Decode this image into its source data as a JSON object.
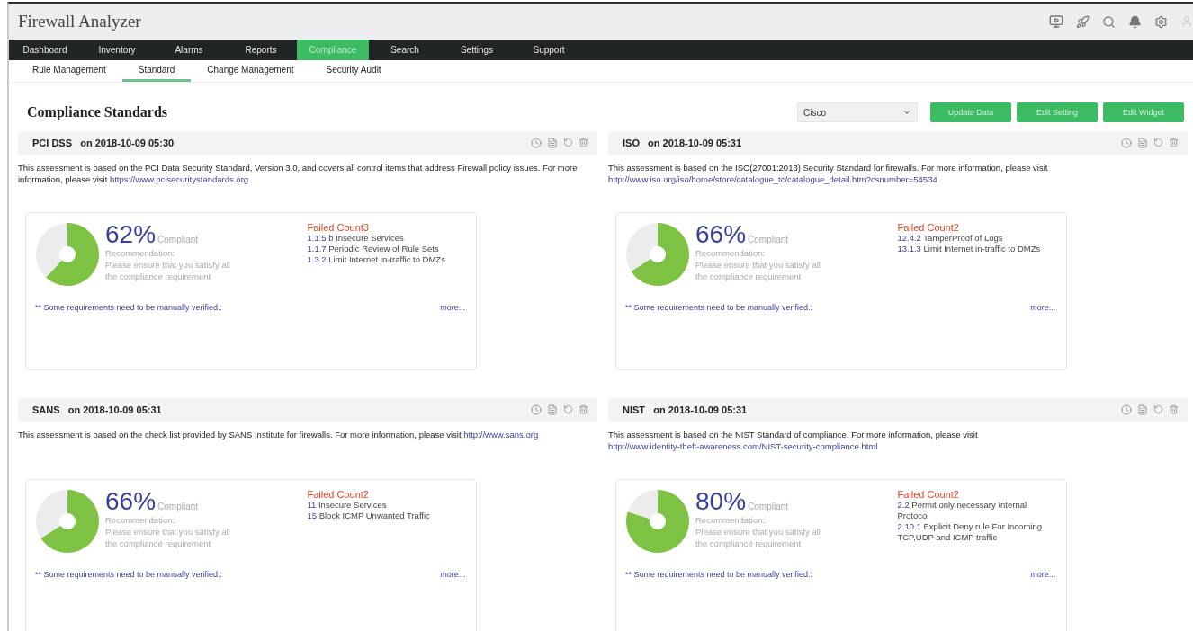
{
  "app_title": "Firewall Analyzer",
  "nav": [
    {
      "label": "Dashboard",
      "selected": false
    },
    {
      "label": "Inventory",
      "selected": false
    },
    {
      "label": "Alarms",
      "selected": false
    },
    {
      "label": "Reports",
      "selected": false
    },
    {
      "label": "Compliance",
      "selected": true
    },
    {
      "label": "Search",
      "selected": false
    },
    {
      "label": "Settings",
      "selected": false
    },
    {
      "label": "Support",
      "selected": false
    }
  ],
  "subnav": [
    {
      "label": "Rule Management",
      "selected": false
    },
    {
      "label": "Standard",
      "selected": true
    },
    {
      "label": "Change Management",
      "selected": false
    },
    {
      "label": "Security Audit",
      "selected": false
    }
  ],
  "page_title": "Compliance Standards",
  "device_select": {
    "value": "Cisco"
  },
  "actions": [
    "Update Data",
    "Edit Setting",
    "Edit Widget"
  ],
  "widgets": [
    {
      "name": "PCI DSS",
      "date": "on 2018-10-09 05:30",
      "description": "This assessment is based on the PCI Data Security Standard, Version 3.0, and covers all control items that address Firewall policy issues. For more information, please visit",
      "link": "https://www.pcisecuritystandards.org",
      "chart_data": {
        "type": "donut",
        "values": [
          62,
          38
        ]
      },
      "percent": "62%",
      "compliant_label": "Compliant",
      "recommendation_label": "Recommendation:",
      "recommendation": "Please ensure that you satisfy all the compliance requirement",
      "failed_label": "Failed Count3",
      "failed_items": [
        {
          "code": "1.1.5 b",
          "text": "Insecure Services"
        },
        {
          "code": "1.1.7",
          "text": "Periodic Review of Rule Sets"
        },
        {
          "code": "1.3.2",
          "text": "Limit Internet in-traffic to DMZs"
        }
      ],
      "manual_note": "** Some requirements need to be manually verified.:",
      "more": "more..."
    },
    {
      "name": "ISO",
      "date": "on 2018-10-09 05:31",
      "description": "This assessment is based on the ISO(27001:2013) Security Standard for firewalls. For more information, please visit",
      "link": "http://www.iso.org/iso/home/store/catalogue_tc/catalogue_detail.htm?csnumber=54534",
      "chart_data": {
        "type": "donut",
        "values": [
          66,
          34
        ]
      },
      "percent": "66%",
      "compliant_label": "Compliant",
      "recommendation_label": "Recommendation:",
      "recommendation": "Please ensure that you satisfy all the compliance requirement",
      "failed_label": "Failed Count2",
      "failed_items": [
        {
          "code": "12.4.2",
          "text": "TamperProof of Logs"
        },
        {
          "code": "13.1.3",
          "text": "Limit Internet in-traffic to DMZs"
        }
      ],
      "manual_note": "** Some requirements need to be manually verified.:",
      "more": "more..."
    },
    {
      "name": "SANS",
      "date": "on 2018-10-09 05:31",
      "description": "This assessment is based on the check list provided by SANS Institute for firewalls. For more information, please visit",
      "link": "http://www.sans.org",
      "chart_data": {
        "type": "donut",
        "values": [
          66,
          34
        ]
      },
      "percent": "66%",
      "compliant_label": "Compliant",
      "recommendation_label": "Recommendation:",
      "recommendation": "Please ensure that you satisfy all the compliance requirement",
      "failed_label": "Failed Count2",
      "failed_items": [
        {
          "code": "11",
          "text": "Insecure Services"
        },
        {
          "code": "15",
          "text": "Block ICMP Unwanted Traffic"
        }
      ],
      "manual_note": "** Some requirements need to be manually verified.:",
      "more": "more..."
    },
    {
      "name": "NIST",
      "date": "on 2018-10-09 05:31",
      "description": "This assessment is based on the NIST Standard of compliance. For more information, please visit",
      "link": "http://www.identity-theft-awareness.com/NIST-security-compliance.html",
      "chart_data": {
        "type": "donut",
        "values": [
          80,
          20
        ]
      },
      "percent": "80%",
      "compliant_label": "Compliant",
      "recommendation_label": "Recommendation:",
      "recommendation": "Please ensure that you satisfy all the compliance requirement",
      "failed_label": "Failed Count2",
      "failed_items": [
        {
          "code": "2.2",
          "text": "Permit only necessary Internal Protocol"
        },
        {
          "code": "2.10.1",
          "text": "Explicit Deny rule For Incoming TCP,UDP and ICMP traffic"
        }
      ],
      "manual_note": "** Some requirements need to be manually verified.:",
      "more": "more..."
    }
  ]
}
